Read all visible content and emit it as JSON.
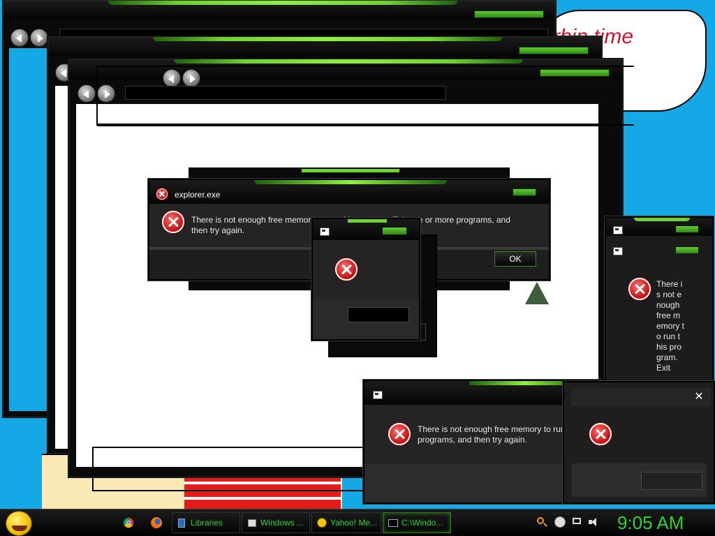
{
  "wallpaper": {
    "comic_text": "rbin time",
    "colors": {
      "sky": "#15a8e6",
      "comic_red": "#e21b1b",
      "comic_text": "#d6122a"
    }
  },
  "windows": {
    "explorer_bg_count": 4
  },
  "dialogs": {
    "main": {
      "title": "explorer.exe",
      "message_line1": "There is not enough free memory to run this program. Exit one or more programs, and",
      "message_line2": "then try again.",
      "ok_label": "OK"
    },
    "small": {
      "ok_label": ""
    },
    "narrow": {
      "message": "There is not enough free memory to run this program. Exit"
    },
    "bottom": {
      "message_line1": "There is not enough free memory to run",
      "message_line2": "programs, and then try again."
    },
    "bottom_right": {
      "close_label": "✕"
    }
  },
  "taskbar": {
    "items": [
      {
        "label": "Libraries",
        "icon": "folder-icon"
      },
      {
        "label": "Windows ...",
        "icon": "window-icon"
      },
      {
        "label": "Yahoo! Me...",
        "icon": "yahoo-messenger-icon"
      },
      {
        "label": "C:\\Windo...",
        "icon": "cmd-icon",
        "active": true
      }
    ],
    "pinned": [
      "chrome-icon",
      "firefox-icon"
    ],
    "clock": "9:05 AM",
    "accent": "#2dd32d"
  }
}
